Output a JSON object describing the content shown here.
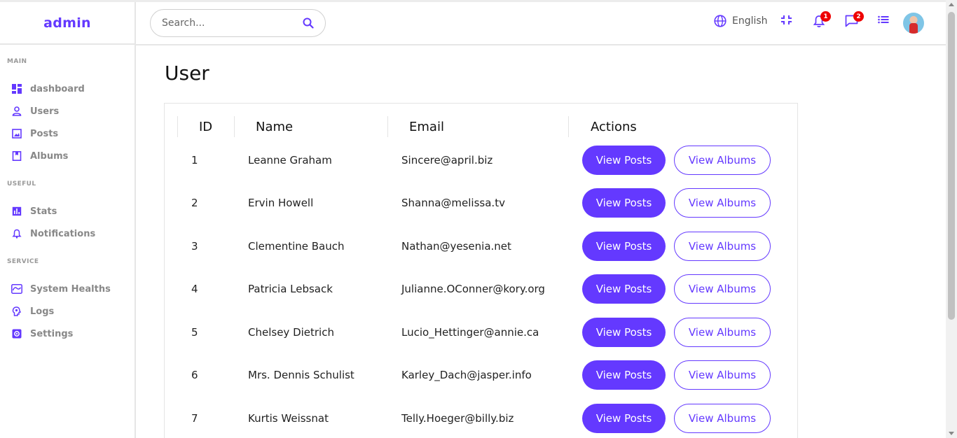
{
  "app": {
    "logo": "admin"
  },
  "colors": {
    "accent": "#6439ff",
    "badge": "#e00000",
    "muted": "#888888"
  },
  "sidebar": {
    "sections": [
      {
        "title": "MAIN",
        "items": [
          {
            "label": "dashboard",
            "icon": "dashboard-icon"
          },
          {
            "label": "Users",
            "icon": "person-icon"
          },
          {
            "label": "Posts",
            "icon": "image-icon"
          },
          {
            "label": "Albums",
            "icon": "album-icon"
          }
        ]
      },
      {
        "title": "USEFUL",
        "items": [
          {
            "label": "Stats",
            "icon": "bar-chart-icon"
          },
          {
            "label": "Notifications",
            "icon": "bell-icon"
          }
        ]
      },
      {
        "title": "SERVICE",
        "items": [
          {
            "label": "System Healths",
            "icon": "health-icon"
          },
          {
            "label": "Logs",
            "icon": "brain-icon"
          },
          {
            "label": "Settings",
            "icon": "settings-icon"
          }
        ]
      }
    ]
  },
  "header": {
    "search_placeholder": "Search...",
    "language": "English",
    "notifications_count": "1",
    "messages_count": "2"
  },
  "page": {
    "title": "User"
  },
  "table": {
    "columns": [
      "ID",
      "Name",
      "Email",
      "Actions"
    ],
    "view_posts_label": "View Posts",
    "view_albums_label": "View Albums",
    "rows": [
      {
        "id": "1",
        "name": "Leanne Graham",
        "email": "Sincere@april.biz"
      },
      {
        "id": "2",
        "name": "Ervin Howell",
        "email": "Shanna@melissa.tv"
      },
      {
        "id": "3",
        "name": "Clementine Bauch",
        "email": "Nathan@yesenia.net"
      },
      {
        "id": "4",
        "name": "Patricia Lebsack",
        "email": "Julianne.OConner@kory.org"
      },
      {
        "id": "5",
        "name": "Chelsey Dietrich",
        "email": "Lucio_Hettinger@annie.ca"
      },
      {
        "id": "6",
        "name": "Mrs. Dennis Schulist",
        "email": "Karley_Dach@jasper.info"
      },
      {
        "id": "7",
        "name": "Kurtis Weissnat",
        "email": "Telly.Hoeger@billy.biz"
      }
    ]
  }
}
